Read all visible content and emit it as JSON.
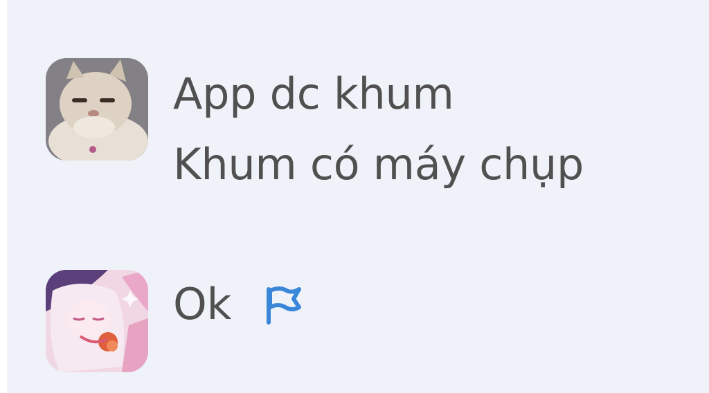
{
  "chat": {
    "messages": [
      {
        "avatar_icon": "cat-avatar-icon",
        "lines": [
          "App dc khum",
          "Khum có máy chụp"
        ]
      },
      {
        "avatar_icon": "anime-girl-avatar-icon",
        "lines": [
          "Ok"
        ],
        "status_icon": "flag-icon"
      }
    ]
  },
  "colors": {
    "panel_bg": "#eff2f8",
    "text": "#505050",
    "flag": "#3a86d8"
  }
}
